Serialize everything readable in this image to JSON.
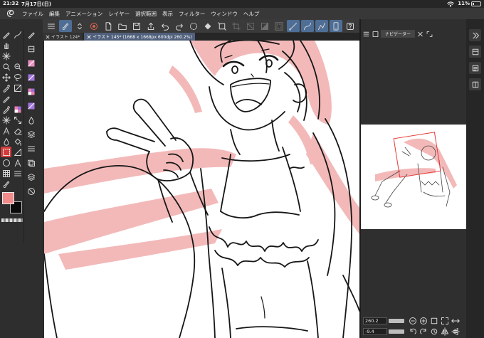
{
  "status_bar": {
    "time": "21:32",
    "date": "7月17日(日)",
    "battery": "11%"
  },
  "menu": {
    "items": [
      "ファイル",
      "編集",
      "アニメーション",
      "レイヤー",
      "選択範囲",
      "表示",
      "フィルター",
      "ウィンドウ",
      "ヘルプ"
    ]
  },
  "command_bar": {
    "icons": [
      "menu-icon",
      "brush-icon",
      "chevrons-icon",
      "color-circle-icon",
      "new-file-icon",
      "open-folder-icon",
      "save-icon",
      "export-icon",
      "undo-icon",
      "redo-icon",
      "clear-icon",
      "fill-icon",
      "transform-icon",
      "crop-icon",
      "deselect-icon",
      "invert-icon",
      "expand-selection-icon",
      "stroke-straight-icon",
      "stroke-curve-icon",
      "stroke-polyline-icon",
      "tablet-icon",
      "help-icon"
    ],
    "selected": [
      "brush-icon",
      "stroke-straight-icon",
      "stroke-curve-icon",
      "stroke-polyline-icon",
      "tablet-icon"
    ],
    "disabled": [
      "crop-icon",
      "deselect-icon",
      "invert-icon",
      "expand-selection-icon"
    ]
  },
  "tools": {
    "column1": [
      "pen-icon",
      "hand-icon",
      "sparkle-icon",
      "zoom-icon",
      "move-icon",
      "eyedropper-icon",
      "pen-icon",
      "eyedropper-icon",
      "sparkle-icon",
      "text-icon",
      "droplet-icon",
      "selection-tool-icon",
      "circle-icon",
      "grid-icon",
      "brush-icon"
    ],
    "column2": [
      "stroke-icon",
      null,
      null,
      "zoom-rotate-icon",
      "lasso-icon",
      "gradient-icon",
      null,
      "pink-checker-icon",
      "expand-icon",
      "eraser-icon",
      "fill-bucket-icon",
      "ruler-icon",
      "text-icon",
      "list-icon",
      null
    ],
    "subtools": [
      "pen-subtool-icon",
      "pencil-subtool-icon",
      "pink-brush-subtool-icon",
      "purple-brush-subtool-icon",
      "pink-checker-icon",
      "purple-brush-subtool-icon",
      "droplet-icon",
      "layer-stack-icon",
      "list-icon",
      "layers-icon",
      "layer-stack-icon",
      "no-entry-icon"
    ],
    "selected": "selection-tool-icon"
  },
  "colors": {
    "foreground": "#f28b8b",
    "background": "#0a0a0a",
    "accent": "#4e6e96",
    "selected_tool": "#d23c3c",
    "hair_pink": "#f3b9b9"
  },
  "canvas_tabs": [
    {
      "label": "イラスト 124*"
    },
    {
      "label": "イラスト 145* (1668 x 1668px 600dpi 260.2%)"
    }
  ],
  "navigator": {
    "tab_label": "ナビゲーター",
    "header_icons_left": [
      "panel-menu-icon",
      "panel-layer-icon"
    ],
    "header_icons_right": [
      "panel-close-icon",
      "panel-expand-icon"
    ],
    "zoom": "260.2",
    "rotation": "-9.4",
    "zoom_buttons": [
      "zoom-out-icon",
      "zoom-in-icon",
      "actual-size-icon",
      "fit-icon",
      "fit-width-icon"
    ],
    "rotation_buttons": [
      "rotate-left-icon",
      "rotate-right-icon",
      "reset-rotation-icon",
      "flip-horizontal-icon",
      "flip-vertical-icon"
    ]
  },
  "right_column": {
    "icons": [
      "panel-collapse-icon",
      "layer-panel-icon",
      "layer-props-icon",
      "material-icon"
    ]
  }
}
